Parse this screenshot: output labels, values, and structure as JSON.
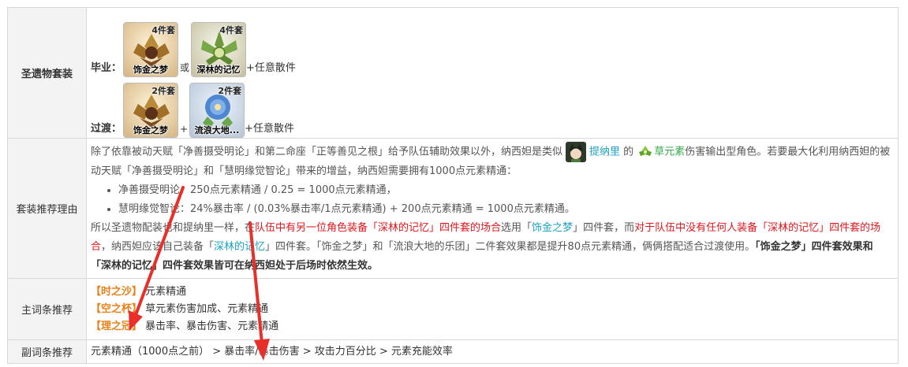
{
  "rows": {
    "artifact_set": {
      "label": "圣遗物套装",
      "best": {
        "tag": "毕业：",
        "items": [
          {
            "badge": "4件套",
            "name": "饰金之梦"
          },
          {
            "badge": "4件套",
            "name": "深林的记忆"
          }
        ],
        "joiner": "或",
        "rest": "+任意散件"
      },
      "transition": {
        "tag": "过渡：",
        "items": [
          {
            "badge": "2件套",
            "name": "饰金之梦"
          },
          {
            "badge": "2件套",
            "name": "流浪大地..."
          }
        ],
        "joiner": "+",
        "rest": "+任意散件"
      }
    },
    "reason": {
      "label": "套装推荐理由",
      "p1_a": "除了依靠被动天赋「净善摄受明论」和第二命座「正等善见之根」给予队伍辅助效果以外，纳西妲是类似",
      "p1_char": "提纳里",
      "p1_b": "的",
      "p1_elem": "草元素",
      "p1_c": "伤害输出型角色。若要最大化利用纳西妲的被动天赋「净善摄受明论」和「慧明缘觉智论」带来的增益，纳西妲需要拥有1000点元素精通：",
      "bullets": [
        "净善摄受明论：250点元素精通 / 0.25 = 1000点元素精通，",
        "慧明缘觉智论：24%暴击率 / (0.03%暴击率/1点元素精通) + 200点元素精通 = 1000点元素精通。"
      ],
      "p2_a": "所以圣遗物配装也和提纳里一样，在",
      "p2_red1": "队伍中有另一位角色装备「深林的记忆」四件套的场合",
      "p2_b": "选用「",
      "p2_cyan1": "饰金之梦",
      "p2_c": "」四件套，而",
      "p2_red2": "对于队伍中没有任何人装备「深林的记忆」四件套的场合",
      "p2_d": "，纳西妲应该自己装备「",
      "p2_cyan2": "深林的记忆",
      "p2_e": "」四件套。「饰金之梦」和「流浪大地的乐团」二件套效果都是提升80点元素精通，俩俩搭配适合过渡使用。",
      "p2_bold": "「饰金之梦」四件套效果和「深林的记忆」四件套效果皆可在纳西妲处于后场时依然生效。"
    },
    "main_stats": {
      "label": "主词条推荐",
      "items": [
        {
          "slot": "【时之沙】",
          "value": "元素精通"
        },
        {
          "slot": "【空之杯】",
          "value": "草元素伤害加成、元素精通"
        },
        {
          "slot": "【理之冠】",
          "value": "暴击率、暴击伤害、元素精通"
        }
      ]
    },
    "sub_stats": {
      "label": "副词条推荐",
      "text": "元素精通（1000点之前） > 暴击率/暴击伤害 > 攻击力百分比 > 元素充能效率"
    }
  },
  "colors": {
    "red_annotation": "#e8302a",
    "slot_orange": "#e8811a",
    "highlight_red": "#e0161c",
    "highlight_cyan": "#1ba3c2"
  }
}
